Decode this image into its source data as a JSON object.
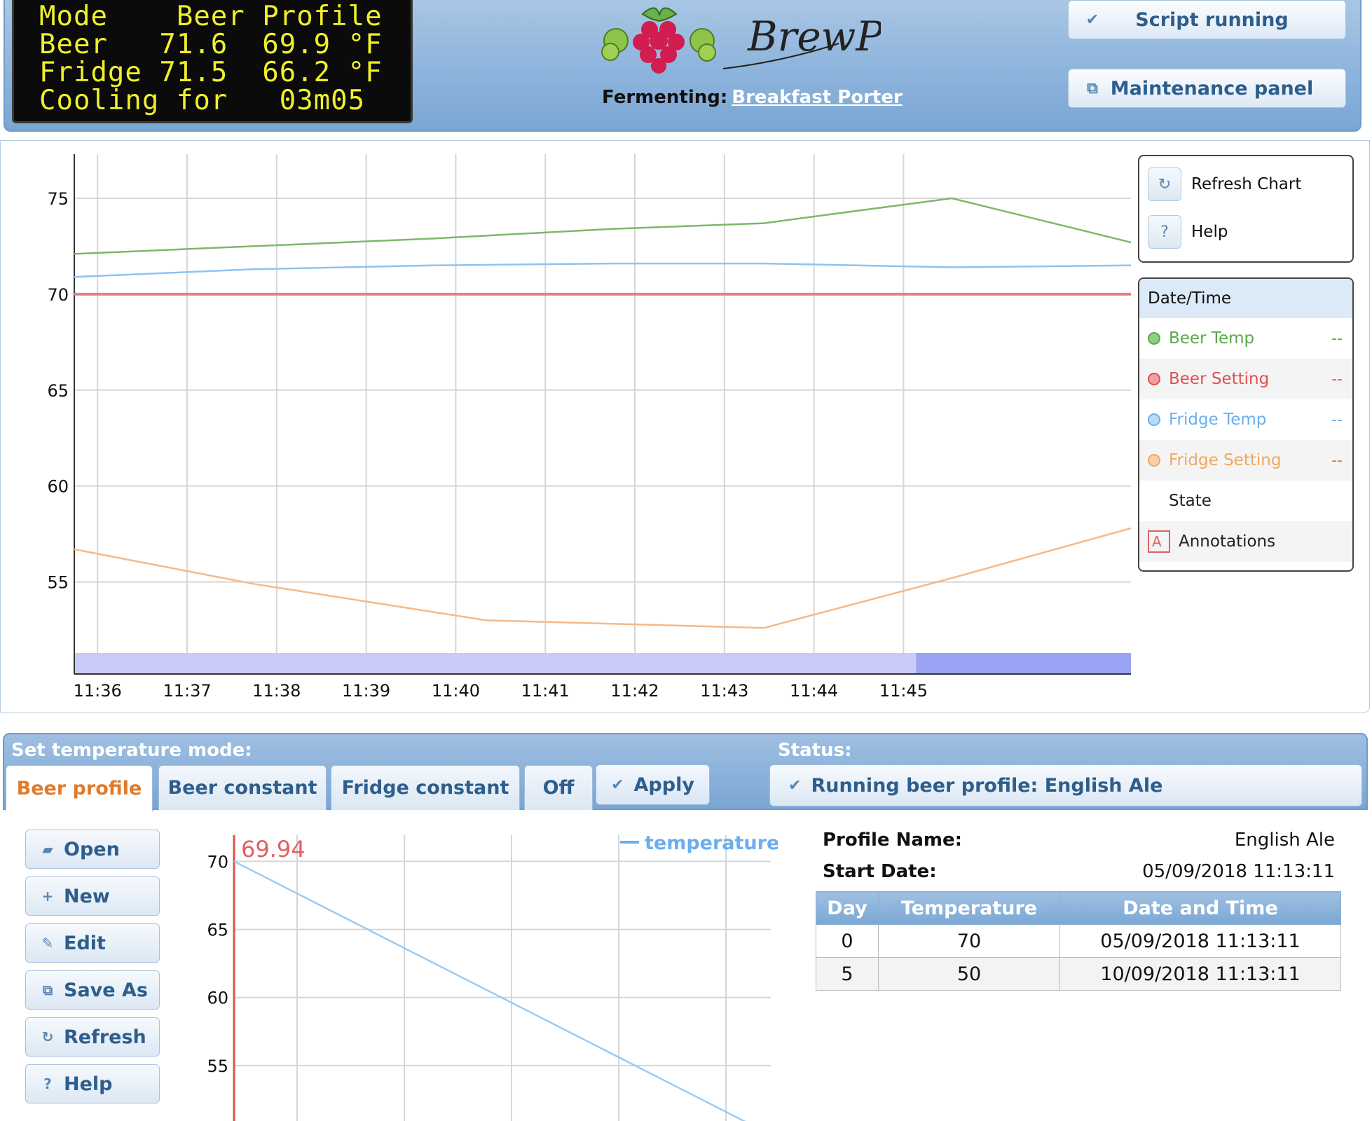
{
  "lcd": {
    "line1": "Mode    Beer Profile",
    "line2": "Beer   71.6  69.9 °F",
    "line3": "Fridge 71.5  66.2 °F",
    "line4": "Cooling for   03m05"
  },
  "brand": {
    "logo_text": "BrewPi"
  },
  "fermenting": {
    "label": "Fermenting:",
    "beer_name": "Breakfast Porter"
  },
  "header_buttons": {
    "script_running": "Script running",
    "maintenance": "Maintenance panel"
  },
  "chart_data": [
    {
      "type": "line",
      "x": [
        "11:35:45",
        "11:36",
        "11:37",
        "11:38",
        "11:39",
        "11:40",
        "11:41",
        "11:41:45",
        "11:42",
        "11:43",
        "11:43:50",
        "11:44",
        "11:45",
        "11:45:40"
      ],
      "x_ticks": [
        "11:36",
        "11:37",
        "11:38",
        "11:39",
        "11:40",
        "11:41",
        "11:42",
        "11:43",
        "11:44",
        "11:45"
      ],
      "y_ticks": [
        "75",
        "70",
        "65",
        "60",
        "55"
      ],
      "ylim": [
        50.2,
        77.3
      ],
      "series": [
        {
          "name": "Beer Temp",
          "color": "#7cb86a",
          "points": [
            [
              0,
              72.1
            ],
            [
              4,
              72.9
            ],
            [
              6,
              73.4
            ],
            [
              7.7,
              73.7
            ],
            [
              9.8,
              75.0
            ],
            [
              11.8,
              72.7
            ]
          ]
        },
        {
          "name": "Beer Setting",
          "color": "#e98080",
          "points": [
            [
              0,
              70.0
            ],
            [
              11.8,
              70.0
            ]
          ]
        },
        {
          "name": "Fridge Temp",
          "color": "#8fc3f0",
          "points": [
            [
              0,
              70.9
            ],
            [
              2,
              71.3
            ],
            [
              4,
              71.5
            ],
            [
              6,
              71.6
            ],
            [
              7.7,
              71.6
            ],
            [
              9.8,
              71.4
            ],
            [
              11.8,
              71.5
            ]
          ]
        },
        {
          "name": "Fridge Setting",
          "color": "#f5b988",
          "points": [
            [
              0,
              56.7
            ],
            [
              2,
              54.9
            ],
            [
              4.6,
              53.0
            ],
            [
              7.7,
              52.6
            ],
            [
              9.8,
              55.2
            ],
            [
              11.8,
              57.8
            ]
          ]
        }
      ],
      "state_band": [
        {
          "from": 0,
          "to": 9.4,
          "color": "#c8cbf8"
        },
        {
          "from": 9.4,
          "to": 11.8,
          "color": "#9aa3f4"
        }
      ]
    },
    {
      "type": "line",
      "legend": "temperature",
      "peak_label": "69.94",
      "y_ticks": [
        "70",
        "65",
        "60",
        "55"
      ],
      "points": [
        [
          0,
          70
        ],
        [
          4,
          50
        ]
      ]
    }
  ],
  "chart_tools": {
    "refresh": "Refresh Chart",
    "help": "Help"
  },
  "legend": {
    "header": "Date/Time",
    "items": [
      {
        "label": "Beer Temp",
        "value": "--",
        "color": "#5aa84a"
      },
      {
        "label": "Beer Setting",
        "value": "--",
        "color": "#e05050"
      },
      {
        "label": "Fridge Temp",
        "value": "--",
        "color": "#6aaef0"
      },
      {
        "label": "Fridge Setting",
        "value": "--",
        "color": "#f0a860"
      },
      {
        "label": "State"
      },
      {
        "label": "Annotations",
        "icon_text": "A"
      }
    ]
  },
  "controls": {
    "title": "Set temperature mode:",
    "status_title": "Status:",
    "tabs": [
      "Beer profile",
      "Beer constant",
      "Fridge constant",
      "Off"
    ],
    "apply": "Apply",
    "status": "Running beer profile: English Ale"
  },
  "side_buttons": [
    "Open",
    "New",
    "Edit",
    "Save As",
    "Refresh",
    "Help"
  ],
  "profile": {
    "name_label": "Profile Name:",
    "name": "English Ale",
    "start_label": "Start Date:",
    "start": "05/09/2018 11:13:11",
    "columns": [
      "Day",
      "Temperature",
      "Date and Time"
    ],
    "rows": [
      [
        "0",
        "70",
        "05/09/2018 11:13:11"
      ],
      [
        "5",
        "50",
        "10/09/2018 11:13:11"
      ]
    ]
  }
}
